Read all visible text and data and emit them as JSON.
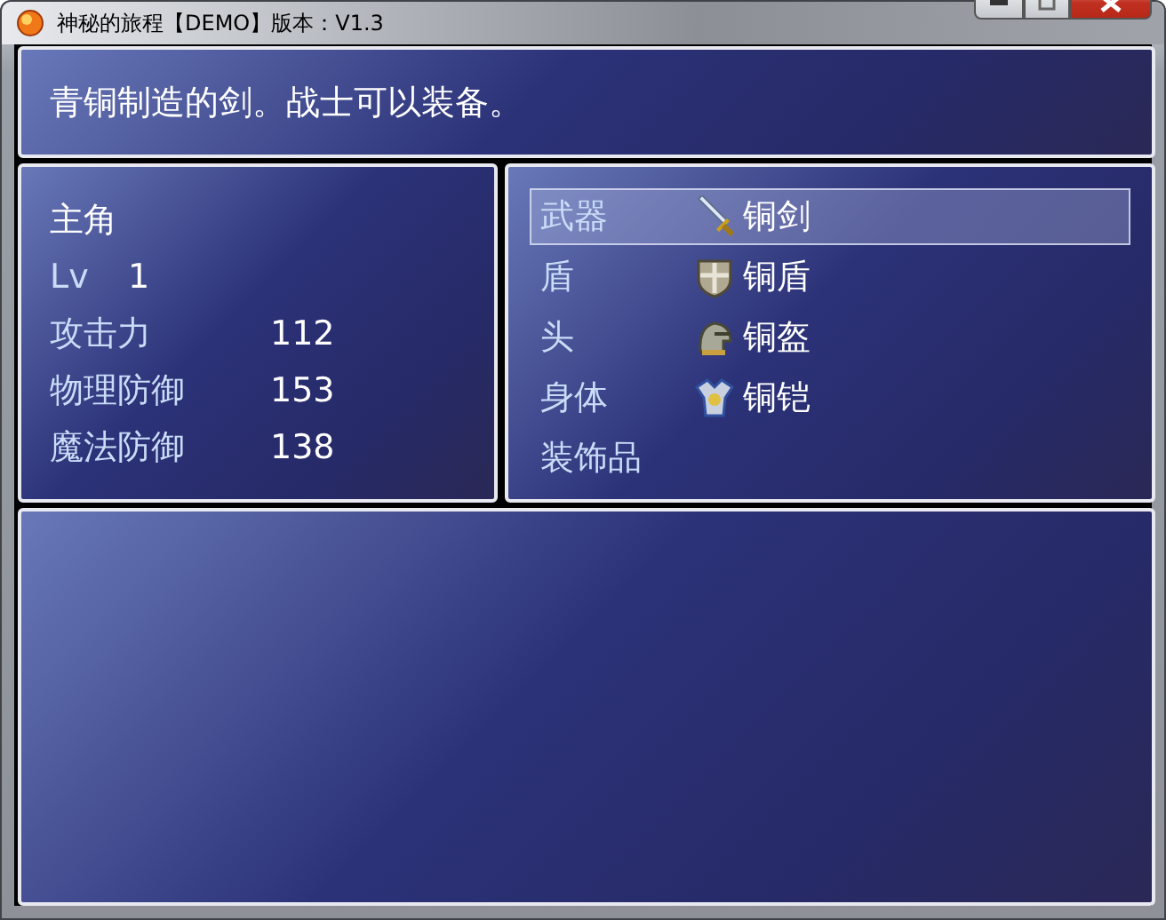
{
  "window": {
    "title": "神秘的旅程【DEMO】版本：V1.3"
  },
  "help": {
    "text": "青铜制造的剑。战士可以装备。"
  },
  "actor": {
    "name": "主角",
    "level_label": "Lv",
    "level": "1",
    "stats": [
      {
        "label": "攻击力",
        "value": "112"
      },
      {
        "label": "物理防御",
        "value": "153"
      },
      {
        "label": "魔法防御",
        "value": "138"
      }
    ]
  },
  "equipment": [
    {
      "slot": "武器",
      "item": "铜剑",
      "kind": "sword",
      "selected": true
    },
    {
      "slot": "盾",
      "item": "铜盾",
      "kind": "shield",
      "selected": false
    },
    {
      "slot": "头",
      "item": "铜盔",
      "kind": "helmet",
      "selected": false
    },
    {
      "slot": "身体",
      "item": "铜铠",
      "kind": "armor",
      "selected": false
    },
    {
      "slot": "装饰品",
      "selected": false
    }
  ]
}
